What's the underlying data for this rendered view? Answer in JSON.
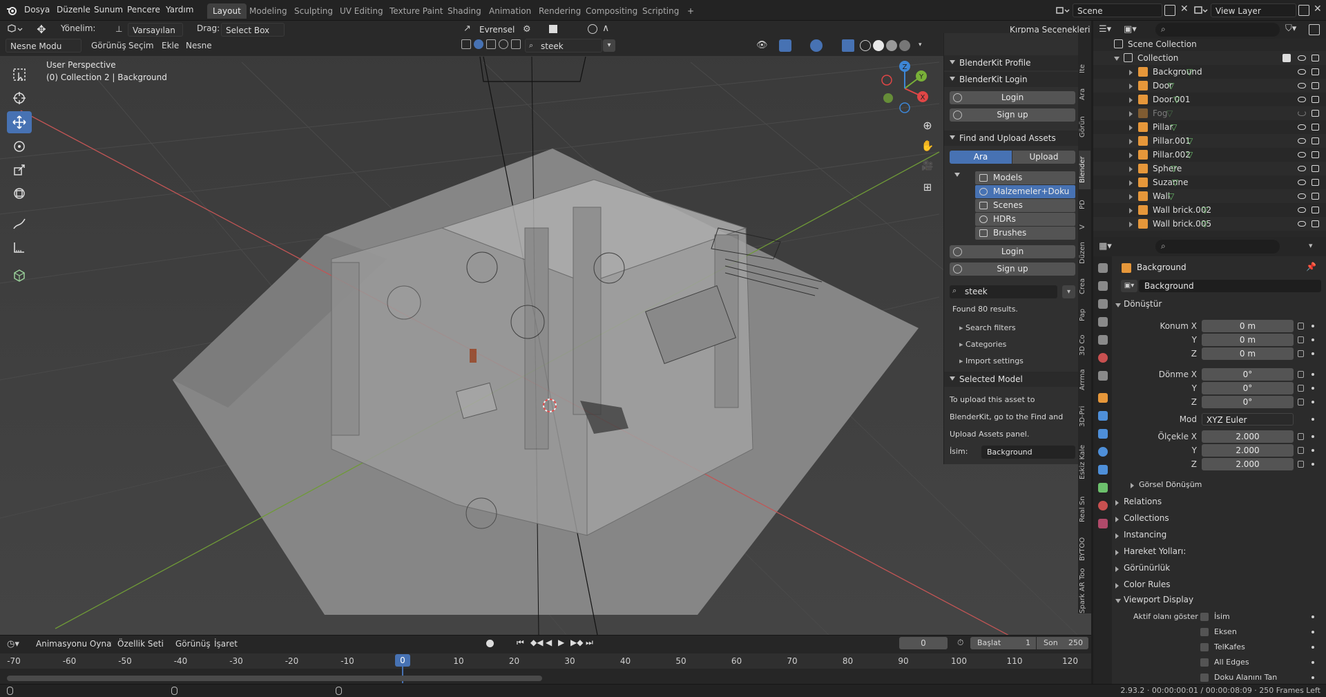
{
  "menubar": {
    "items": [
      "Dosya",
      "Düzenle",
      "Sunum",
      "Pencere",
      "Yardım"
    ],
    "workspace_tabs": [
      "Layout",
      "Modeling",
      "Sculpting",
      "UV Editing",
      "Texture Paint",
      "Shading",
      "Animation",
      "Rendering",
      "Compositing",
      "Scripting"
    ],
    "active_tab": "Layout",
    "add_tab": "+",
    "scene_label": "Scene",
    "view_layer_label": "View Layer"
  },
  "tool_header": {
    "orientation_label": "Yönelim:",
    "orientation_value": "Varsayılan",
    "drag_label": "Drag:",
    "drag_value": "Select Box",
    "pivot_value": "Evrensel",
    "clipping_options": "Kırpma Seçenekleri"
  },
  "viewport_header": {
    "mode": "Nesne Modu",
    "menus": [
      "Görünüş",
      "Seçim",
      "Ekle",
      "Nesne"
    ],
    "search_value": "steek"
  },
  "viewport": {
    "perspective_label": "User Perspective",
    "collection_label": "(0) Collection 2 | Background",
    "gizmo_axes": [
      "X",
      "Y",
      "Z"
    ]
  },
  "npanel": {
    "sections": {
      "profile": "BlenderKit Profile",
      "login_section": "BlenderKit Login",
      "find_upload": "Find and Upload Assets",
      "selected_model": "Selected Model"
    },
    "login_btn": "Login",
    "signup_btn": "Sign up",
    "search_tab": "Ara",
    "upload_tab": "Upload",
    "asset_types": [
      "Models",
      "Malzemeler+Doku",
      "Scenes",
      "HDRs",
      "Brushes"
    ],
    "selected_asset_type": "Malzemeler+Doku",
    "search_value": "steek",
    "found_results": "Found 80 results.",
    "expanders": [
      "Search filters",
      "Categories",
      "Import settings"
    ],
    "upload_info_lines": [
      "To upload this asset to",
      "BlenderKit, go to the Find and",
      "Upload Assets panel."
    ],
    "name_label": "İsim:",
    "name_value": "Background"
  },
  "side_tabs": [
    "Ite",
    "Ara",
    "Görün",
    "Blender",
    "PD",
    "V",
    "Düzen",
    "Crea",
    "Pap",
    "3D Co",
    "Arrma",
    "3D-Pri",
    "Eskiz Kale",
    "Real Sn",
    "BYTOO",
    "Spark AR Too"
  ],
  "active_side_tab": "Blender",
  "outliner": {
    "scene_collection": "Scene Collection",
    "collection": "Collection",
    "items": [
      "Background",
      "Door",
      "Door.001",
      "Fog",
      "Pillar",
      "Pillar.001",
      "Pillar.002",
      "Sphere",
      "Suzanne",
      "Wall",
      "Wall brick.002",
      "Wall brick.005"
    ],
    "dimmed_item": "Fog"
  },
  "properties": {
    "object_name": "Background",
    "data_name": "Background",
    "transform_header": "Dönüştür",
    "location_label": "Konum X",
    "location": [
      "0 m",
      "0 m",
      "0 m"
    ],
    "rotation_label": "Dönme X",
    "rotation": [
      "0°",
      "0°",
      "0°"
    ],
    "axis_y": "Y",
    "axis_z": "Z",
    "mode_label": "Mod",
    "mode_value": "XYZ Euler",
    "scale_label": "Ölçekle X",
    "scale": [
      "2.000",
      "2.000",
      "2.000"
    ],
    "delta_transform": "Görsel Dönüşüm",
    "collapsed_panels": [
      "Relations",
      "Collections",
      "Instancing",
      "Hareket Yolları:",
      "Görünürlük",
      "Color Rules"
    ],
    "viewport_display": "Viewport Display",
    "show_active_label": "Aktif olanı göster",
    "checkboxes": [
      "İsim",
      "Eksen",
      "TelKafes",
      "All Edges",
      "Doku Alanını Tan"
    ]
  },
  "timeline": {
    "playback": "Animasyonu Oynat",
    "keying": "Özellik Seti",
    "view": "Görünüş",
    "marker": "İşaret",
    "current_frame": "0",
    "start_label": "Başlat",
    "start_value": "1",
    "end_label": "Son",
    "end_value": "250",
    "ruler_ticks": [
      "-70",
      "-60",
      "-50",
      "-40",
      "-30",
      "-20",
      "-10",
      "0",
      "10",
      "20",
      "30",
      "40",
      "50",
      "60",
      "70",
      "80",
      "90",
      "100",
      "110",
      "120"
    ],
    "playhead": "0"
  },
  "status_bar": {
    "version_info": "2.93.2 · 00:00:00:01 / 00:00:08:09 · 250 Frames Left"
  },
  "colors": {
    "accent": "#4772b3",
    "object_orange": "#e6973a",
    "mesh_green": "#6cc06c",
    "axis_x": "#e04646",
    "axis_y": "#79b038",
    "axis_z": "#3d86d6"
  }
}
